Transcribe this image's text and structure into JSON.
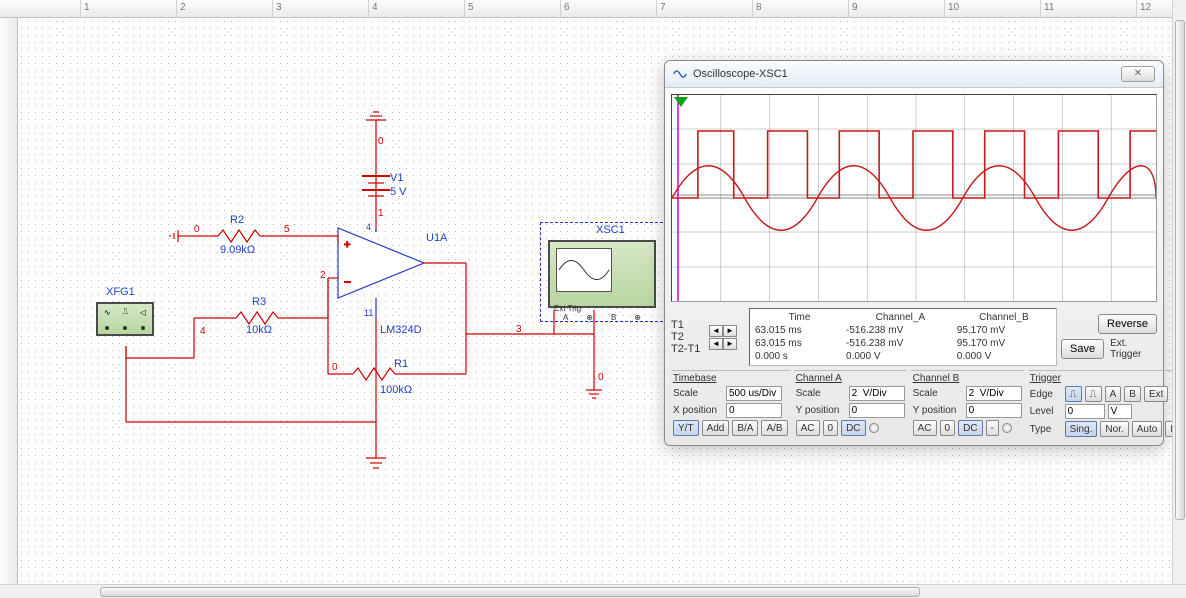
{
  "ruler": {
    "ticks": [
      "1",
      "2",
      "3",
      "4",
      "5",
      "6",
      "7",
      "8",
      "9",
      "10",
      "11",
      "12"
    ]
  },
  "circuit": {
    "xfg1": {
      "name": "XFG1"
    },
    "xsc1": {
      "name": "XSC1",
      "side_label": "Ext Trig",
      "pin_a": "A",
      "pin_b": "B"
    },
    "r1": {
      "name": "R1",
      "value": "100kΩ"
    },
    "r2": {
      "name": "R2",
      "value": "9.09kΩ"
    },
    "r3": {
      "name": "R3",
      "value": "10kΩ"
    },
    "v1": {
      "name": "V1",
      "value": "5 V"
    },
    "u1a": {
      "name": "U1A",
      "part": "LM324D",
      "pin_plus": "4",
      "pin_minus": "11",
      "pin_in1": "3",
      "pin_in2": "2",
      "pin_out": "1"
    },
    "nets": {
      "n0": "0",
      "n1": "1",
      "n2": "2",
      "n3": "3",
      "n4": "4",
      "n5": "5"
    }
  },
  "scope": {
    "title": "Oscilloscope-XSC1",
    "close": "✕",
    "t1": "T1",
    "t2": "T2",
    "t2t1": "T2-T1",
    "cols": {
      "time": "Time",
      "cha": "Channel_A",
      "chb": "Channel_B"
    },
    "rows": {
      "r1": {
        "time": "63.015 ms",
        "a": "-516.238 mV",
        "b": "95.170 mV"
      },
      "r2": {
        "time": "63.015 ms",
        "a": "-516.238 mV",
        "b": "95.170 mV"
      },
      "r3": {
        "time": "0.000 s",
        "a": "0.000 V",
        "b": "0.000 V"
      }
    },
    "reverse": "Reverse",
    "save": "Save",
    "ext_trigger": "Ext. Trigger",
    "timebase": {
      "hdr": "Timebase",
      "scale_lbl": "Scale",
      "scale_val": "500 us/Div",
      "xpos_lbl": "X position",
      "xpos_val": "0",
      "yt": "Y/T",
      "add": "Add",
      "ba": "B/A",
      "ab": "A/B"
    },
    "cha": {
      "hdr": "Channel A",
      "scale_lbl": "Scale",
      "scale_val": "2  V/Div",
      "ypos_lbl": "Y position",
      "ypos_val": "0",
      "ac": "AC",
      "zero": "0",
      "dc": "DC"
    },
    "chb": {
      "hdr": "Channel B",
      "scale_lbl": "Scale",
      "scale_val": "2  V/Div",
      "ypos_lbl": "Y position",
      "ypos_val": "0",
      "ac": "AC",
      "zero": "0",
      "dc": "DC",
      "minus": "-"
    },
    "trig": {
      "hdr": "Trigger",
      "edge_lbl": "Edge",
      "level_lbl": "Level",
      "level_val": "0",
      "level_unit": "V",
      "type_lbl": "Type",
      "edge_rising": "⎍",
      "edge_falling": "⎍",
      "edge_a": "A",
      "edge_b": "B",
      "edge_ext": "Ext",
      "sing": "Sing.",
      "nor": "Nor.",
      "auto": "Auto",
      "none": "None"
    }
  }
}
